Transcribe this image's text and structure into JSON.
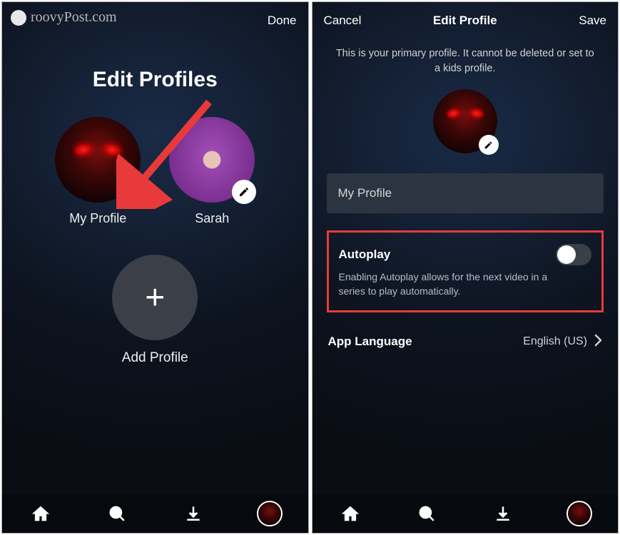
{
  "watermark": "roovyPost.com",
  "screen1": {
    "done": "Done",
    "title": "Edit Profiles",
    "profiles": [
      {
        "name": "My Profile"
      },
      {
        "name": "Sarah"
      }
    ],
    "add_label": "Add Profile"
  },
  "screen2": {
    "cancel": "Cancel",
    "title": "Edit Profile",
    "save": "Save",
    "primary_note": "This is your primary profile. It cannot be deleted or set to a kids profile.",
    "name_value": "My Profile",
    "autoplay": {
      "title": "Autoplay",
      "desc": "Enabling Autoplay allows for the next video in a series to play automatically."
    },
    "language": {
      "label": "App Language",
      "value": "English (US)"
    }
  }
}
